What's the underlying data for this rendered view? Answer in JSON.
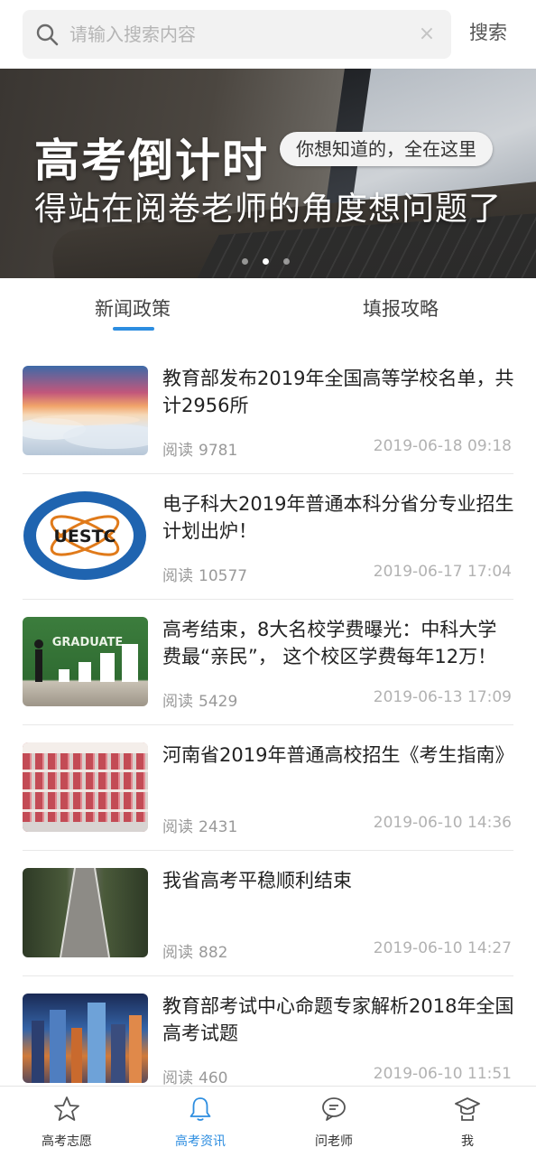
{
  "search": {
    "placeholder": "请输入搜索内容",
    "clear_icon": "close-icon",
    "button_label": "搜索"
  },
  "banner": {
    "title": "高考倒计时",
    "bubble": "你想知道的，全在这里",
    "subtitle": "得站在阅卷老师的角度想问题了",
    "dots_total": 3,
    "active_dot": 2
  },
  "tabs": [
    {
      "label": "新闻政策",
      "active": true
    },
    {
      "label": "填报攻略",
      "active": false
    }
  ],
  "news": [
    {
      "title": "教育部发布2019年全国高等学校名单，共计2956所",
      "reads_label": "阅读",
      "reads": "9781",
      "date": "2019-06-18 09:18",
      "thumb": "sea-of-clouds"
    },
    {
      "title": "电子科大2019年普通本科分省分专业招生计划出炉！",
      "reads_label": "阅读",
      "reads": "10577",
      "date": "2019-06-17 17:04",
      "thumb": "uestc-logo",
      "logo_text": "UESTC"
    },
    {
      "title": "高考结束，8大名校学费曝光：中科大学费最“亲民”， 这个校区学费每年12万！",
      "reads_label": "阅读",
      "reads": "5429",
      "date": "2019-06-13 17:09",
      "thumb": "graduate-chalkboard",
      "thumb_text": "GRADUATE"
    },
    {
      "title": "河南省2019年普通高校招生《考生指南》",
      "reads_label": "阅读",
      "reads": "2431",
      "date": "2019-06-10 14:36",
      "thumb": "library-shelves"
    },
    {
      "title": "我省高考平稳顺利结束",
      "reads_label": "阅读",
      "reads": "882",
      "date": "2019-06-10 14:27",
      "thumb": "suspension-bridge"
    },
    {
      "title": "教育部考试中心命题专家解析2018年全国高考试题",
      "reads_label": "阅读",
      "reads": "460",
      "date": "2019-06-10 11:51",
      "thumb": "city-night"
    }
  ],
  "bottom_nav": [
    {
      "label": "高考志愿",
      "icon": "star-icon",
      "active": false
    },
    {
      "label": "高考资讯",
      "icon": "bell-icon",
      "active": true
    },
    {
      "label": "问老师",
      "icon": "chat-icon",
      "active": false
    },
    {
      "label": "我",
      "icon": "graduate-cap-icon",
      "active": false
    }
  ],
  "colors": {
    "accent": "#2c8de0",
    "text": "#222222",
    "muted": "#999999"
  }
}
